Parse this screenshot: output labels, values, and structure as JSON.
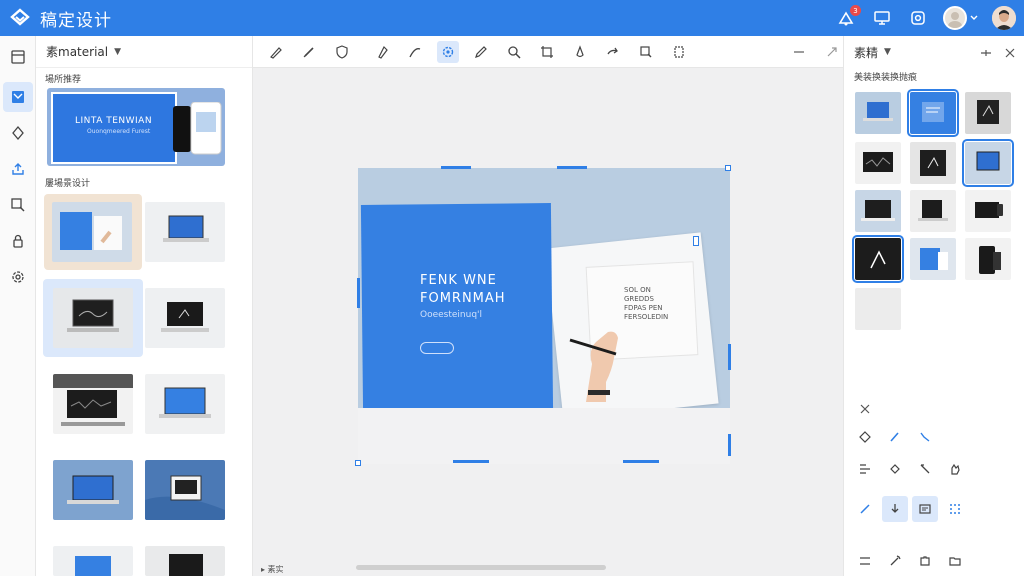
{
  "app": {
    "title": "稿定设计",
    "notification_count": "3"
  },
  "colors": {
    "brand": "#2f7fe6",
    "active_bg": "#dbe8fb",
    "card_blue": "#3580e2"
  },
  "left_panel": {
    "header": "素material",
    "section1": "場所推荐",
    "section2": "屢場景设计",
    "big_template": {
      "title": "LINTA TENWIAN",
      "subtitle": "Ouonqmeered Furest"
    }
  },
  "canvas": {
    "card_title_line1": "FENK WNE",
    "card_title_line2": "FOMRNMAH",
    "card_subtitle": "Ooeesteinuq'l",
    "booklet_text": [
      "SOL ON",
      "GREDDS",
      "FDPAS PEN",
      "FERSOLEDIN"
    ],
    "bottom_label": "▸ 素实"
  },
  "right_panel": {
    "header": "素精",
    "subtitle": "美装换装换抛痕"
  }
}
